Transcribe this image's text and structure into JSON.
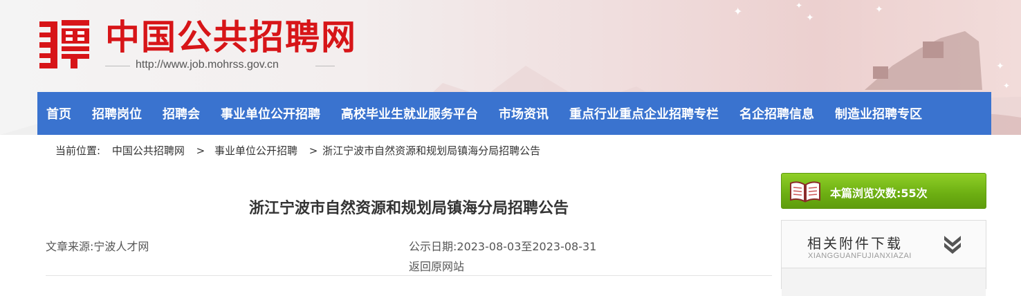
{
  "site": {
    "title": "中国公共招聘网",
    "url": "http://www.job.mohrss.gov.cn"
  },
  "nav": {
    "items": [
      "首页",
      "招聘岗位",
      "招聘会",
      "事业单位公开招聘",
      "高校毕业生就业服务平台",
      "市场资讯",
      "重点行业重点企业招聘专栏",
      "名企招聘信息",
      "制造业招聘专区"
    ]
  },
  "breadcrumb": {
    "label": "当前位置:",
    "items": [
      "中国公共招聘网",
      "事业单位公开招聘",
      "浙江宁波市自然资源和规划局镇海分局招聘公告"
    ],
    "separator": ">"
  },
  "article": {
    "title": "浙江宁波市自然资源和规划局镇海分局招聘公告",
    "source": "文章来源:宁波人才网",
    "date": "公示日期:2023-08-03至2023-08-31",
    "back_link": "返回原网站"
  },
  "sidebar": {
    "views_text": "本篇浏览次数:55次",
    "attachments_title": "相关附件下载",
    "attachments_pinyin": "XIANGGUANFUJIANXIAZAI"
  },
  "colors": {
    "nav_bg": "#3a73cf",
    "brand_red": "#d71518",
    "views_green": "#6cae12"
  }
}
